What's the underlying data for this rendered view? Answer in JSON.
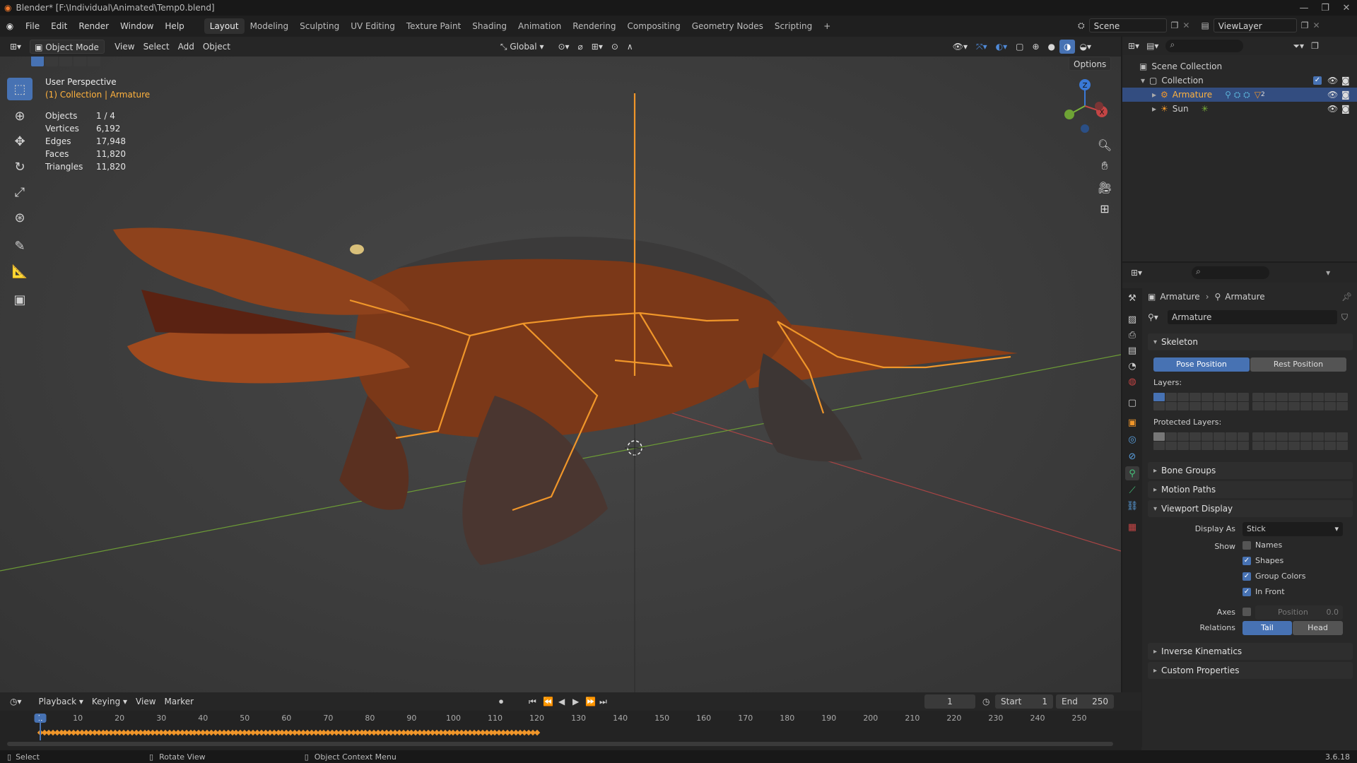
{
  "window": {
    "title": "Blender* [F:\\Individual\\Animated\\Temp0.blend]"
  },
  "menu": [
    "File",
    "Edit",
    "Render",
    "Window",
    "Help"
  ],
  "workspaces": [
    "Layout",
    "Modeling",
    "Sculpting",
    "UV Editing",
    "Texture Paint",
    "Shading",
    "Animation",
    "Rendering",
    "Compositing",
    "Geometry Nodes",
    "Scripting"
  ],
  "active_workspace": "Layout",
  "scene": {
    "name": "Scene",
    "view_layer": "ViewLayer"
  },
  "viewport_header": {
    "mode": "Object Mode",
    "menus": [
      "View",
      "Select",
      "Add",
      "Object"
    ],
    "orientation": "Global",
    "options": "Options"
  },
  "viewport": {
    "perspective": "User Perspective",
    "collection": "(1) Collection | Armature",
    "stats": [
      {
        "label": "Objects",
        "value": "1 / 4"
      },
      {
        "label": "Vertices",
        "value": "6,192"
      },
      {
        "label": "Edges",
        "value": "17,948"
      },
      {
        "label": "Faces",
        "value": "11,820"
      },
      {
        "label": "Triangles",
        "value": "11,820"
      }
    ],
    "gizmo": {
      "z": "Z",
      "x": "X"
    }
  },
  "outliner": {
    "scene_collection": "Scene Collection",
    "collection": "Collection",
    "items": [
      {
        "name": "Armature",
        "selected": true
      },
      {
        "name": "Sun",
        "selected": false
      }
    ],
    "armature_count": "2"
  },
  "properties": {
    "breadcrumb": [
      "Armature",
      "Armature"
    ],
    "data_name": "Armature",
    "skeleton": {
      "title": "Skeleton",
      "pose_position": "Pose Position",
      "rest_position": "Rest Position",
      "layers_label": "Layers:",
      "protected_layers_label": "Protected Layers:"
    },
    "bone_groups": "Bone Groups",
    "motion_paths": "Motion Paths",
    "viewport_display": {
      "title": "Viewport Display",
      "display_as_label": "Display As",
      "display_as_value": "Stick",
      "show_label": "Show",
      "names": "Names",
      "shapes": "Shapes",
      "group_colors": "Group Colors",
      "in_front": "In Front",
      "axes_label": "Axes",
      "position_label": "Position",
      "position_value": "0.0",
      "relations_label": "Relations",
      "tail": "Tail",
      "head": "Head",
      "checked": {
        "names": false,
        "shapes": true,
        "group_colors": true,
        "in_front": true,
        "axes": false
      }
    },
    "inverse_kinematics": "Inverse Kinematics",
    "custom_properties": "Custom Properties"
  },
  "timeline": {
    "menus": [
      "Playback",
      "Keying",
      "View",
      "Marker"
    ],
    "current_frame": "1",
    "start_label": "Start",
    "start": "1",
    "end_label": "End",
    "end": "250",
    "ticks": [
      "1",
      "10",
      "20",
      "30",
      "40",
      "50",
      "60",
      "70",
      "80",
      "90",
      "100",
      "110",
      "120",
      "130",
      "140",
      "150",
      "160",
      "170",
      "180",
      "190",
      "200",
      "210",
      "220",
      "230",
      "240",
      "250"
    ],
    "key_start": 1,
    "key_end": 120,
    "frame_end": 250
  },
  "statusbar": {
    "select": "Select",
    "rotate": "Rotate View",
    "context": "Object Context Menu",
    "version": "3.6.18"
  },
  "colors": {
    "accent": "#4772b3",
    "bone": "#f0962a",
    "active_text": "#ffb23e",
    "x_axis": "#c44545",
    "y_axis": "#7ab33a",
    "z_axis": "#3a79d6"
  }
}
